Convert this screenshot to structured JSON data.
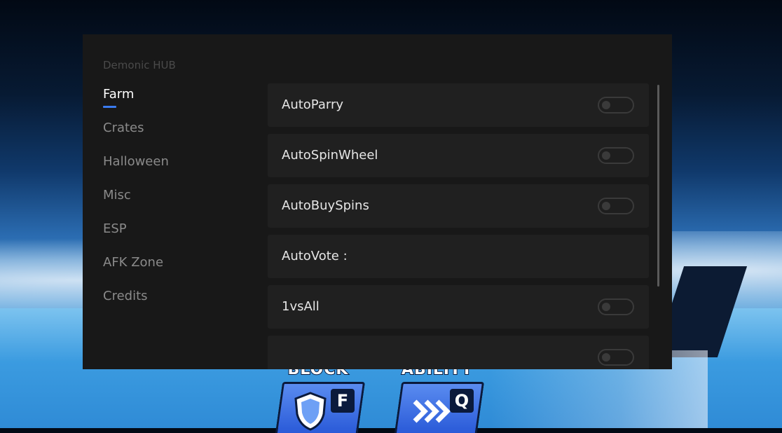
{
  "hub": {
    "title": "Demonic HUB",
    "nav": [
      {
        "label": "Farm",
        "active": true
      },
      {
        "label": "Crates",
        "active": false
      },
      {
        "label": "Halloween",
        "active": false
      },
      {
        "label": "Misc",
        "active": false
      },
      {
        "label": "ESP",
        "active": false
      },
      {
        "label": "AFK Zone",
        "active": false
      },
      {
        "label": "Credits",
        "active": false
      }
    ],
    "rows": [
      {
        "label": "AutoParry",
        "toggle": "off"
      },
      {
        "label": "AutoSpinWheel",
        "toggle": "off"
      },
      {
        "label": "AutoBuySpins",
        "toggle": "off"
      },
      {
        "label": "AutoVote :",
        "toggle": null
      },
      {
        "label": "1vsAll",
        "toggle": "off"
      }
    ]
  },
  "abilities": [
    {
      "label": "BLOCK",
      "key": "F",
      "icon": "shield-icon"
    },
    {
      "label": "ABILITY",
      "key": "Q",
      "icon": "dash-arrows-icon"
    }
  ],
  "colors": {
    "accent": "#3a7bf0",
    "window_bg": "#181818",
    "row_bg": "#202020"
  }
}
